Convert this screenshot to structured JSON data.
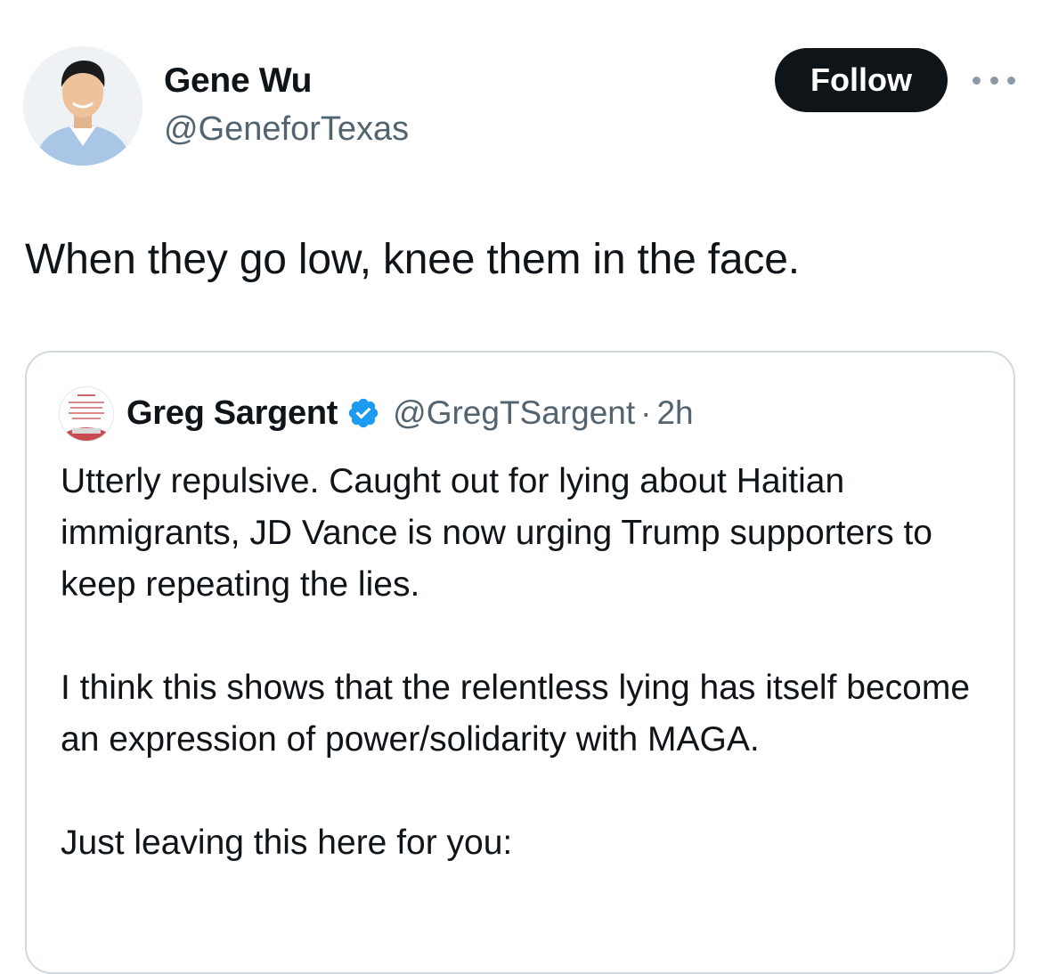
{
  "tweet": {
    "author": {
      "name": "Gene Wu",
      "handle": "@GeneforTexas",
      "avatar": "profile-photo"
    },
    "follow_label": "Follow",
    "more_icon": "ellipsis-icon",
    "text": "When they go low, knee them in the face."
  },
  "quoted_tweet": {
    "author": {
      "name": "Greg Sargent",
      "handle": "@GregTSargent",
      "verified": true,
      "verified_color": "#1d9bf0",
      "avatar": "book-cover-avatar"
    },
    "separator": "·",
    "time": "2h",
    "paragraphs": [
      "Utterly repulsive. Caught out for lying about Haitian immigrants, JD Vance is now urging Trump supporters to keep repeating the lies.",
      "I think this shows that the relentless lying has itself become an expression of power/solidarity with MAGA.",
      "Just leaving this here for you:"
    ]
  },
  "colors": {
    "text_primary": "#0f1419",
    "text_secondary": "#536471",
    "follow_bg": "#0f1419",
    "follow_text": "#ffffff",
    "border": "#cfd9de",
    "verified": "#1d9bf0"
  }
}
